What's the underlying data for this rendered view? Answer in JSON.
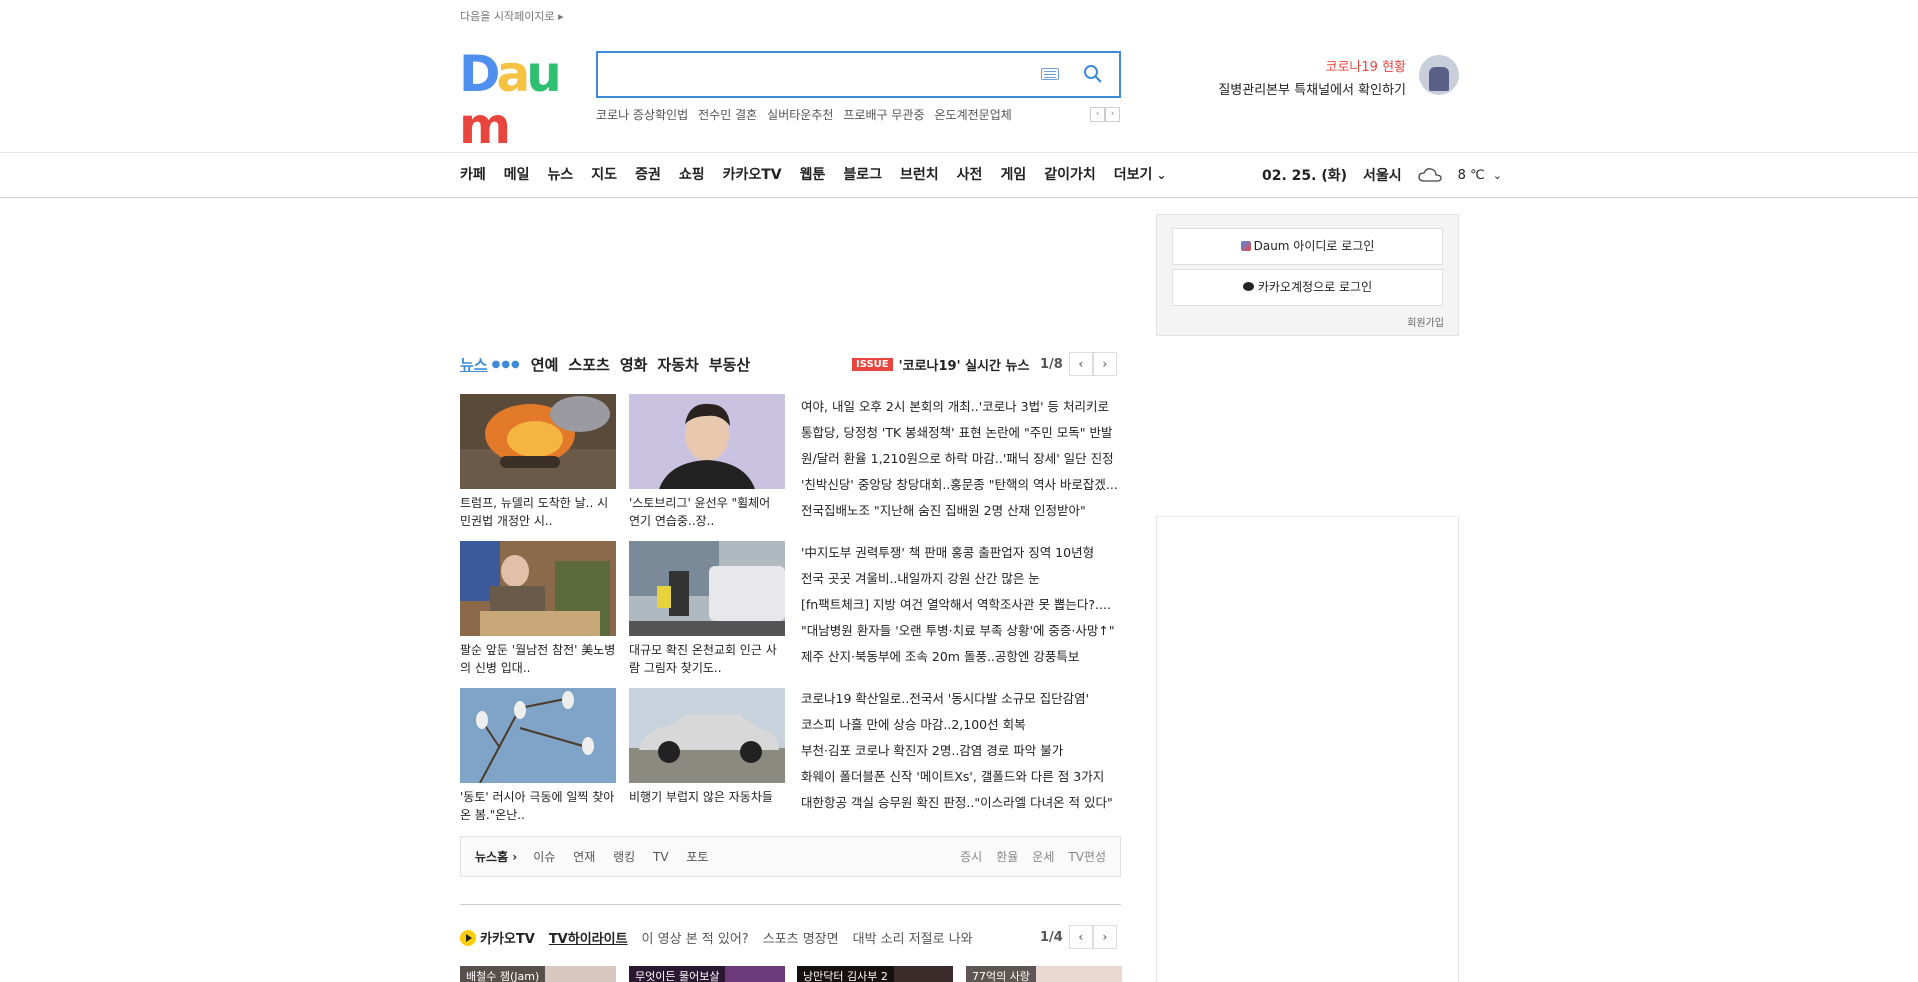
{
  "header": {
    "start_page": "다음을 시작페이지로 ▸",
    "logo": "Daum",
    "search_placeholder": "",
    "suggestions": [
      "코로나 증상확인법",
      "전수민 결혼",
      "실버타운추천",
      "프로배구 무관중",
      "온도계전문업체"
    ],
    "corona_title": "코로나19 현황",
    "corona_sub": "질병관리본부 특채널에서 확인하기"
  },
  "nav": {
    "items": [
      "카페",
      "메일",
      "뉴스",
      "지도",
      "증권",
      "쇼핑",
      "카카오TV",
      "웹툰",
      "블로그",
      "브런치",
      "사전",
      "게임",
      "같이가치"
    ],
    "more": "더보기",
    "date": "02. 25. (화)",
    "city": "서울시",
    "temp": "8 ℃"
  },
  "login": {
    "daum_login": "Daum 아이디로 로그인",
    "kakao_login": "카카오계정으로 로그인",
    "join": "회원가입"
  },
  "news": {
    "tabs": [
      "뉴스",
      "연예",
      "스포츠",
      "영화",
      "자동차",
      "부동산"
    ],
    "issue_badge": "ISSUE",
    "issue_title": "'코로나19' 실시간 뉴스",
    "page": "1/8",
    "thumbs": [
      {
        "caption": "트럼프, 뉴델리 도착한 날.. 시민권법 개정안 시.."
      },
      {
        "caption": "'스토브리그' 윤선우 \"휠체어 연기 연습중..장.."
      },
      {
        "caption": "팔순 앞둔 '월남전 참전' 美노병의 신병 입대.."
      },
      {
        "caption": "대규모 확진 온천교회 인근 사람 그림자 찾기도.."
      },
      {
        "caption": "'동토' 러시아 극동에 일찍 찾아온 봄.\"온난.."
      },
      {
        "caption": "비행기 부럽지 않은 자동차들"
      }
    ],
    "headlines_1": [
      "여야, 내일 오후 2시 본회의 개최..'코로나 3법' 등 처리키로",
      "통합당, 당정청 'TK 봉쇄정책' 표현 논란에 \"주민 모독\" 반발",
      "원/달러 환율 1,210원으로 하락 마감..'패닉 장세' 일단 진정",
      "'친박신당' 중앙당 창당대회..홍문종 \"탄핵의 역사 바로잡겠...",
      "전국집배노조 \"지난해 숨진 집배원 2명 산재 인정받아\""
    ],
    "headlines_2": [
      "'中지도부 권력투쟁' 책 판매 홍콩 출판업자 징역 10년형",
      "전국 곳곳 겨울비..내일까지 강원 산간 많은 눈",
      "[fn팩트체크] 지방 여건 열악해서 역학조사관 못 뽑는다?....",
      "\"대남병원 환자들 '오랜 투병·치료 부족 상황'에 중증·사망↑\"",
      "제주 산지·북동부에 조속 20m 돌풍..공항엔 강풍특보"
    ],
    "headlines_3": [
      "코로나19 확산일로..전국서 '동시다발 소규모 집단감염'",
      "코스피 나흘 만에 상승 마감..2,100선 회복",
      "부천·김포 코로나 확진자 2명..감염 경로 파악 불가",
      "화웨이 폴더블폰 신작 '메이트Xs', 갤폴드와 다른 점 3가지",
      "대한항공 객실 승무원 확진 판정..\"이스라엘 다녀온 적 있다\""
    ],
    "footer_home": "뉴스홈 ›",
    "footer_left": [
      "이슈",
      "연재",
      "랭킹",
      "TV",
      "포토"
    ],
    "footer_right": [
      "증시",
      "환율",
      "운세",
      "TV편성"
    ]
  },
  "kakaotv": {
    "title": "카카오TV",
    "tabs": [
      "TV하이라이트",
      "이 영상 본 적 있어?",
      "스포츠 명장면",
      "대박 소리 저절로 나와"
    ],
    "page": "1/4",
    "videos": [
      "배철수 잼(Jam)",
      "무엇이든 물어보살",
      "낭만닥터 김사부 2",
      "77억의 사랑"
    ]
  },
  "colors": {
    "accent": "#3e8bd9",
    "red": "#e9453f",
    "yellow": "#ffcd00"
  }
}
